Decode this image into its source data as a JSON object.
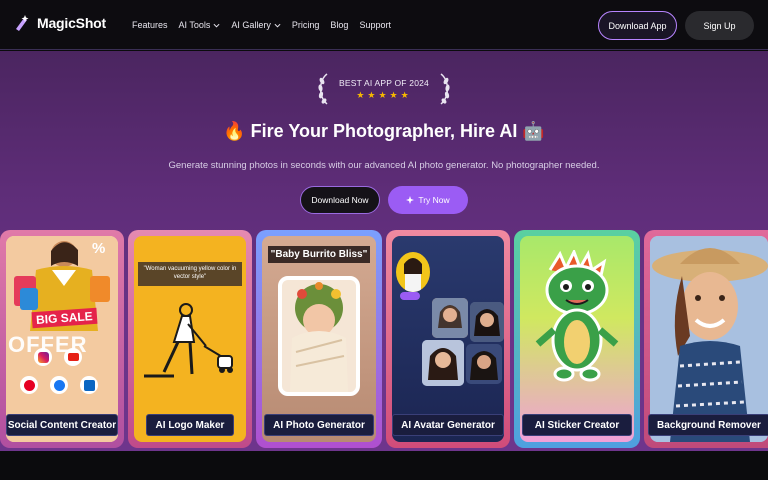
{
  "brand": {
    "name": "MagicShot"
  },
  "nav": {
    "items": [
      {
        "label": "Features",
        "dropdown": false
      },
      {
        "label": "AI Tools",
        "dropdown": true
      },
      {
        "label": "AI Gallery",
        "dropdown": true
      },
      {
        "label": "Pricing",
        "dropdown": false
      },
      {
        "label": "Blog",
        "dropdown": false
      },
      {
        "label": "Support",
        "dropdown": false
      }
    ],
    "download_app_label": "Download App",
    "sign_up_label": "Sign Up"
  },
  "hero": {
    "award_text": "BEST AI APP OF 2024",
    "award_stars": "★★★★★",
    "headline": "🔥 Fire Your Photographer, Hire AI 🤖",
    "subline": "Generate stunning photos in seconds with our advanced AI photo generator. No photographer needed.",
    "download_now_label": "Download Now",
    "try_now_label": "Try Now"
  },
  "cards": [
    {
      "label": "Social Content Creator",
      "sale_text": "BIG SALE",
      "offer_text": "OFFER",
      "percent": "%"
    },
    {
      "label": "AI Logo Maker",
      "prompt": "\"Woman vacuuming yellow color in vector style\""
    },
    {
      "label": "AI Photo Generator",
      "prompt": "\"Baby Burrito Bliss\""
    },
    {
      "label": "AI Avatar Generator"
    },
    {
      "label": "AI Sticker Creator"
    },
    {
      "label": "Background Remover"
    }
  ],
  "colors": {
    "accent": "#9b5cf4",
    "hero_top": "#4b2560",
    "hero_bottom": "#6e358c",
    "star": "#f5b800"
  }
}
